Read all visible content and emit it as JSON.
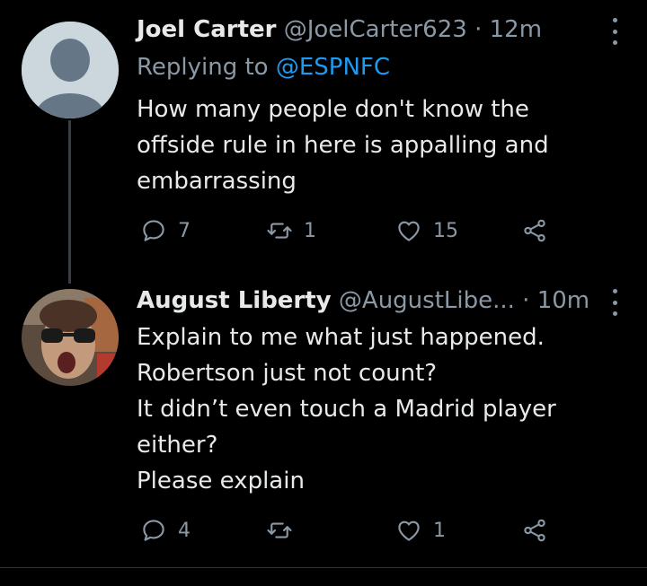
{
  "tweets": [
    {
      "name": "Joel Carter",
      "handle": "@JoelCarter623",
      "time": "12m",
      "replying_prefix": "Replying to",
      "replying_to": "@ESPNFC",
      "lines": [
        "How many people don't know the",
        "offside rule in here is appalling and",
        "embarrassing"
      ],
      "replies": "7",
      "retweets": "1",
      "likes": "15"
    },
    {
      "name": "August Liberty",
      "handle": "@AugustLibe...",
      "time": "10m",
      "lines": [
        "Explain to me what just happened.",
        "Robertson just not count?",
        "It didn’t even touch a Madrid player",
        "either?",
        "Please explain"
      ],
      "replies": "4",
      "retweets": "",
      "likes": "1"
    }
  ],
  "colors": {
    "link": "#1d9bf0",
    "muted": "#8b98a5",
    "text": "#e7e9ea",
    "background": "#000000"
  },
  "icons": [
    "reply-icon",
    "retweet-icon",
    "like-icon",
    "share-icon",
    "more-icon",
    "default-avatar",
    "user-avatar"
  ]
}
